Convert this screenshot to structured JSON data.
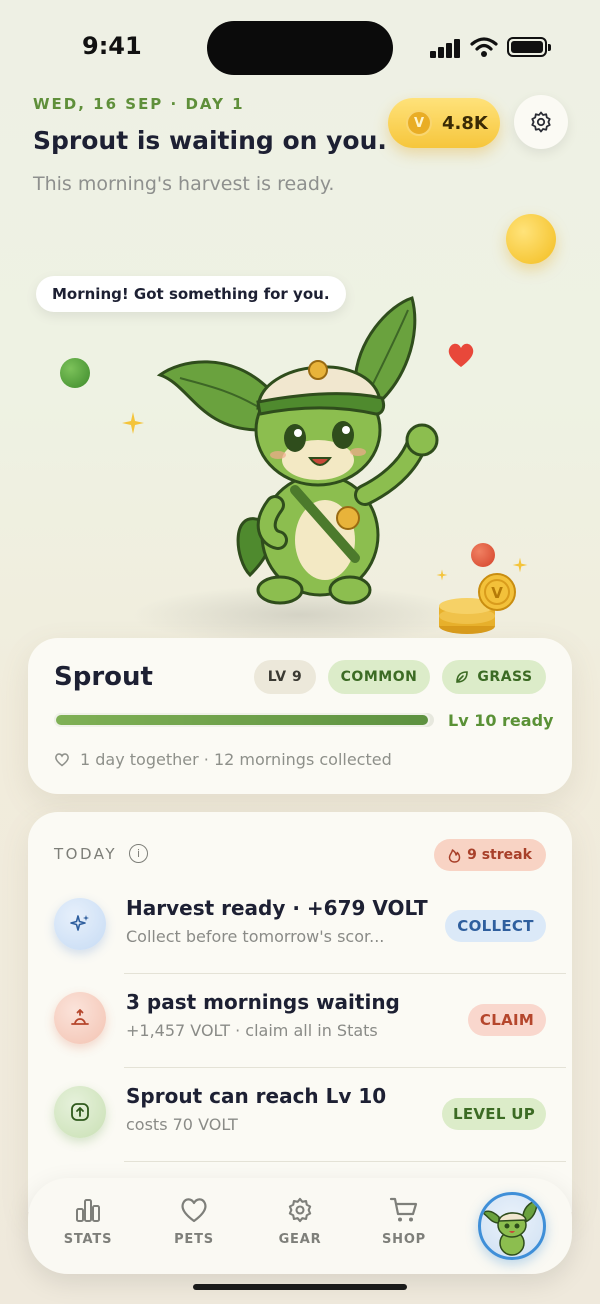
{
  "status_bar": {
    "time": "9:41"
  },
  "header": {
    "date_line": "WED, 16 SEP · DAY 1",
    "headline": "Sprout is waiting on you.",
    "subline": "This morning's harvest is ready.",
    "coin_balance": "4.8K",
    "coin_symbol": "V"
  },
  "speech_bubble": "Morning! Got something for you.",
  "pet": {
    "name": "Sprout",
    "level_chip": "LV 9",
    "rarity_chip": "COMMON",
    "type_chip": "GRASS",
    "xp_progress": 0.99,
    "xp_label": "Lv 10 ready",
    "together_text": "1 day together · 12 mornings collected"
  },
  "today": {
    "label": "TODAY",
    "info_symbol": "i",
    "streak": "9 streak",
    "tasks": [
      {
        "title": "Harvest ready · +679 VOLT",
        "subtitle": "Collect before tomorrow's scor...",
        "button": "COLLECT",
        "icon": "sparkles-icon"
      },
      {
        "title": "3 past mornings waiting",
        "subtitle": "+1,457 VOLT · claim all in Stats",
        "button": "CLAIM",
        "icon": "sunrise-icon"
      },
      {
        "title": "Sprout can reach Lv 10",
        "subtitle": "costs 70 VOLT",
        "button": "LEVEL UP",
        "icon": "arrow-up-circle-icon"
      }
    ]
  },
  "tabs": [
    {
      "label": "STATS",
      "icon": "bar-chart-icon"
    },
    {
      "label": "PETS",
      "icon": "heart-icon"
    },
    {
      "label": "GEAR",
      "icon": "gear-icon"
    },
    {
      "label": "SHOP",
      "icon": "cart-icon"
    }
  ],
  "colors": {
    "accent_green": "#5a9136",
    "coin_gold": "#f6c63c",
    "collect_blue": "#dbe9f8",
    "claim_red": "#f9d7cd",
    "levelup_green": "#dcecc9",
    "avatar_ring": "#3f8fd8"
  }
}
